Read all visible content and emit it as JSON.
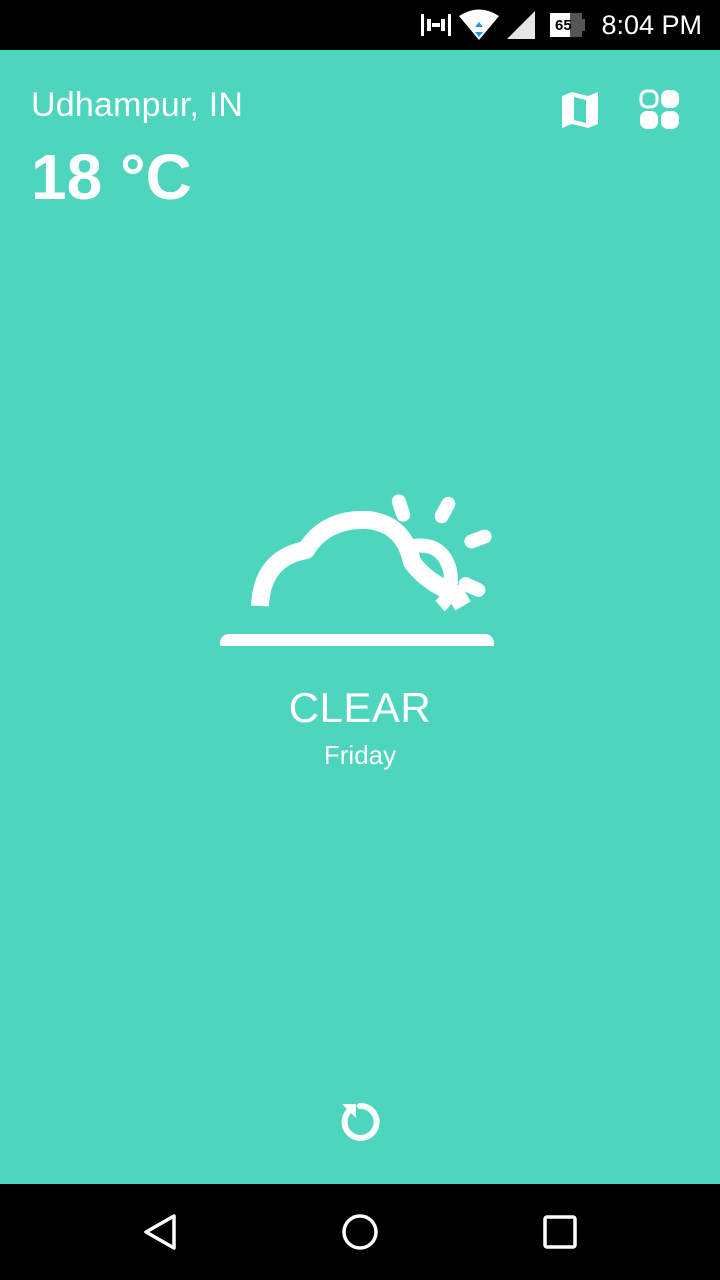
{
  "status_bar": {
    "time": "8:04 PM",
    "battery_level": "65",
    "icons": [
      "vibrate-icon",
      "wifi-icon",
      "cell-signal-icon",
      "battery-icon"
    ]
  },
  "weather": {
    "location": "Udhampur, IN",
    "temperature": "18 °C",
    "condition": "CLEAR",
    "day": "Friday",
    "condition_icon": "partly-cloudy-icon"
  },
  "toolbar": {
    "icons": [
      "map-icon",
      "grid-icon"
    ]
  },
  "actions": {
    "refresh_icon": "refresh-icon"
  },
  "navigation": {
    "buttons": [
      "back",
      "home",
      "recents"
    ]
  },
  "colors": {
    "background": "#4dd5be",
    "foreground": "#ffffff",
    "system_bars": "#000000"
  }
}
